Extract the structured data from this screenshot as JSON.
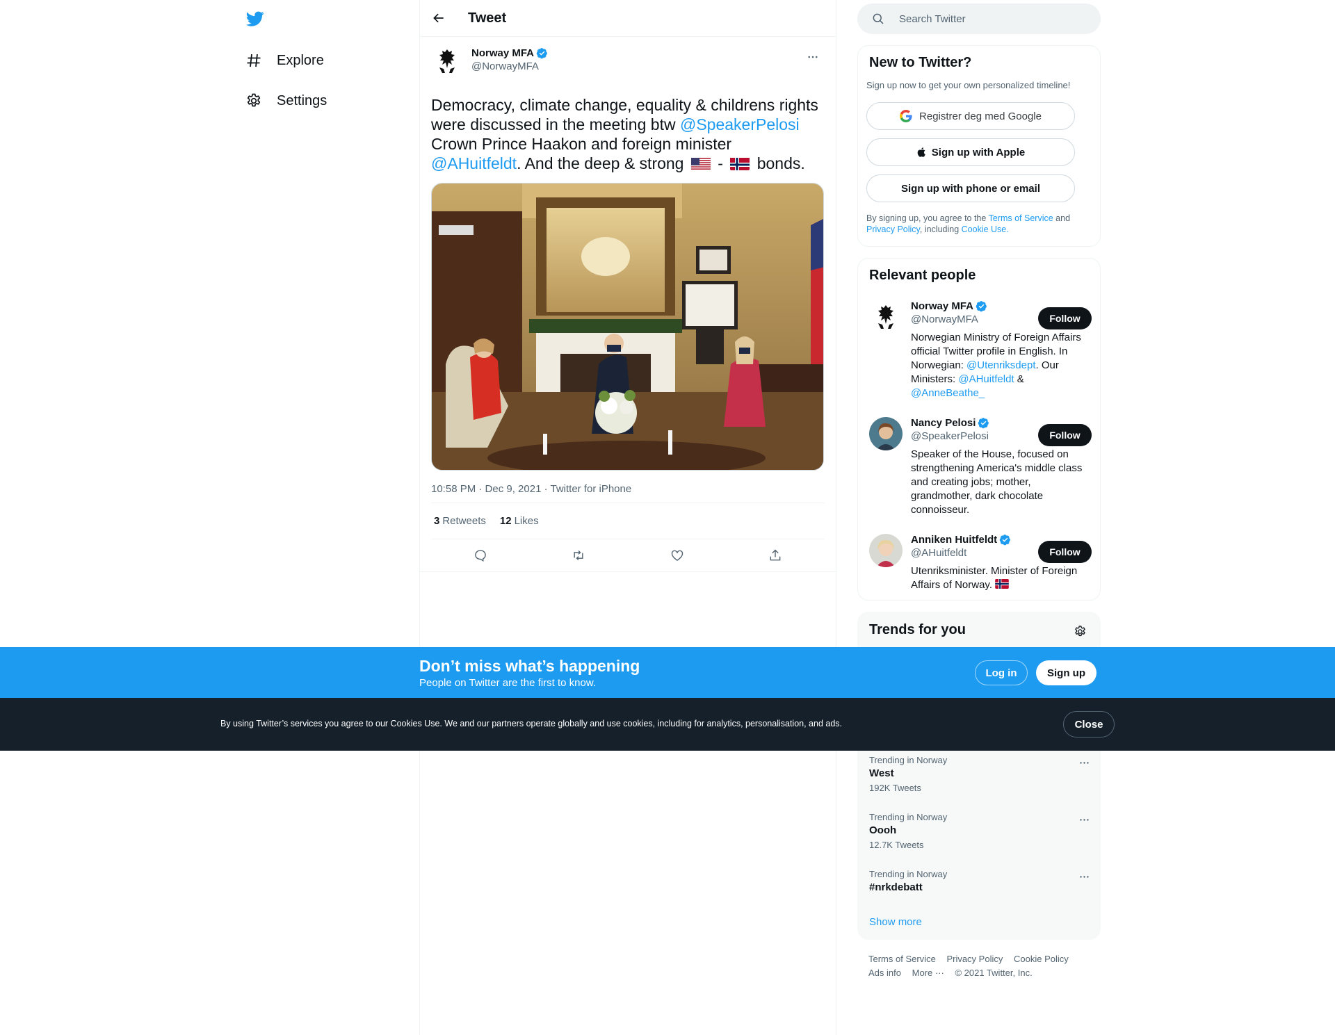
{
  "nav": {
    "explore": "Explore",
    "settings": "Settings"
  },
  "header": {
    "title": "Tweet"
  },
  "tweet": {
    "author_name": "Norway MFA",
    "author_handle": "@NorwayMFA",
    "text_1": "Democracy, climate change, equality & childrens rights were discussed in the meeting btw ",
    "mention_1": "@SpeakerPelosi",
    "text_2": " Crown Prince Haakon and foreign minister ",
    "mention_2": "@AHuitfeldt",
    "text_3": ". And the deep & strong ",
    "text_4": " - ",
    "text_5": " bonds.",
    "media_alt": "Nancy Pelosi meeting Crown Prince Haakon and Anniken Huitfeldt",
    "timestamp": "10:58 PM · Dec 9, 2021 · Twitter for iPhone",
    "retweets": "3",
    "retweets_label": "Retweets",
    "likes": "12",
    "likes_label": "Likes"
  },
  "search": {
    "placeholder": "Search Twitter"
  },
  "signup": {
    "title": "New to Twitter?",
    "subtitle": "Sign up now to get your own personalized timeline!",
    "google": "Registrer deg med Google",
    "apple": "Sign up with Apple",
    "phone": "Sign up with phone or email",
    "legal_1": "By signing up, you agree to the ",
    "tos": "Terms of Service",
    "legal_2": " and ",
    "privacy": "Privacy Policy",
    "legal_3": ", including ",
    "cookie": "Cookie Use."
  },
  "people": {
    "title": "Relevant people",
    "follow_label": "Follow",
    "items": [
      {
        "name": "Norway MFA",
        "handle": "@NorwayMFA",
        "bio_1": "Norwegian Ministry of Foreign Affairs official Twitter profile in English. In Norwegian: ",
        "bio_m1": "@Utenriksdept",
        "bio_2": ". Our Ministers: ",
        "bio_m2": "@AHuitfeldt",
        "bio_3": " & ",
        "bio_m3": "@AnneBeathe_"
      },
      {
        "name": "Nancy Pelosi",
        "handle": "@SpeakerPelosi",
        "bio": "Speaker of the House, focused on strengthening America's middle class and creating jobs; mother, grandmother, dark chocolate connoisseur."
      },
      {
        "name": "Anniken Huitfeldt",
        "handle": "@AHuitfeldt",
        "bio": "Utenriksminister. Minister of Foreign Affairs of Norway."
      }
    ]
  },
  "trends": {
    "title": "Trends for you",
    "items": [
      {
        "context": "Trending in Norway",
        "name": "West",
        "count": "192K Tweets"
      },
      {
        "context": "Trending in Norway",
        "name": "Oooh",
        "count": "12.7K Tweets"
      },
      {
        "context": "Trending in Norway",
        "name": "#nrkdebatt",
        "count": ""
      }
    ],
    "show_more": "Show more"
  },
  "footer": {
    "tos": "Terms of Service",
    "privacy": "Privacy Policy",
    "cookie": "Cookie Policy",
    "ads": "Ads info",
    "more": "More ···",
    "copyright": "© 2021 Twitter, Inc."
  },
  "banner": {
    "title": "Don’t miss what’s happening",
    "subtitle": "People on Twitter are the first to know.",
    "login": "Log in",
    "signup": "Sign up"
  },
  "cookie_bar": {
    "text": "By using Twitter’s services you agree to our Cookies Use. We and our partners operate globally and use cookies, including for analytics, personalisation, and ads.",
    "close": "Close"
  },
  "colors": {
    "accent": "#1d9bf0",
    "text": "#0f1419",
    "muted": "#536471",
    "cookie_bg": "#15202b"
  }
}
